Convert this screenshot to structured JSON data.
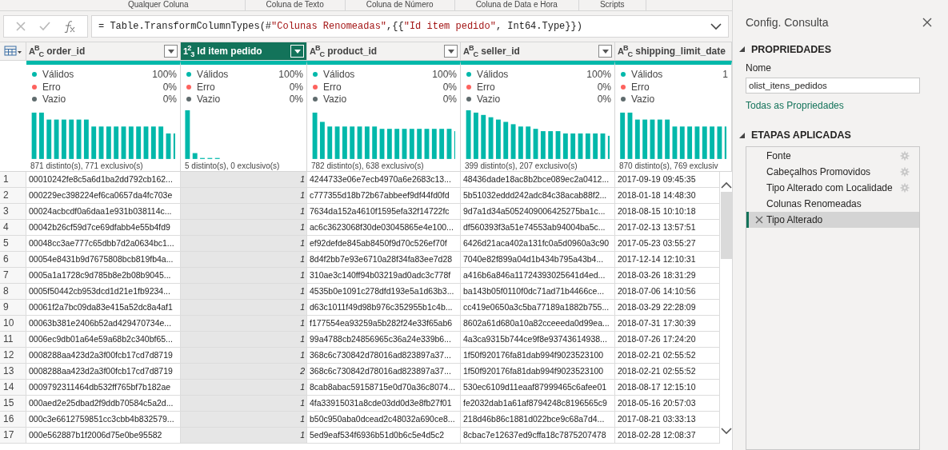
{
  "ribbon": {
    "groups": [
      "Qualquer Coluna",
      "Coluna de Texto",
      "Coluna de Número",
      "Coluna de Data e Hora",
      "Scripts"
    ]
  },
  "formula_bar": {
    "formula": "= Table.TransformColumnTypes(#\"Colunas Renomeadas\",{{\"Id item pedido\", Int64.Type}})"
  },
  "table": {
    "columns": [
      {
        "name": "order_id",
        "type_label": "A$^{B}$$_{C}$",
        "selected": false,
        "has_filter": true,
        "stats": [
          {
            "label": "Válidos",
            "value": "100%",
            "color": "#01b8aa"
          },
          {
            "label": "Erro",
            "value": "0%",
            "color": "#fd625e"
          },
          {
            "label": "Vazio",
            "value": "0%",
            "color": "#5f6b6d"
          }
        ],
        "distinct": "871 distinto(s), 771 exclusivo(s)"
      },
      {
        "name": "Id item pedido",
        "type_label": "1$^{2}$$_{3}$",
        "selected": true,
        "has_filter": true,
        "stats": [
          {
            "label": "Válidos",
            "value": "100%",
            "color": "#01b8aa"
          },
          {
            "label": "Erro",
            "value": "0%",
            "color": "#fd625e"
          },
          {
            "label": "Vazio",
            "value": "0%",
            "color": "#5f6b6d"
          }
        ],
        "distinct": "5 distinto(s), 0 exclusivo(s)"
      },
      {
        "name": "product_id",
        "type_label": "A$^{B}$$_{C}$",
        "selected": false,
        "has_filter": true,
        "stats": [
          {
            "label": "Válidos",
            "value": "100%",
            "color": "#01b8aa"
          },
          {
            "label": "Erro",
            "value": "0%",
            "color": "#fd625e"
          },
          {
            "label": "Vazio",
            "value": "0%",
            "color": "#5f6b6d"
          }
        ],
        "distinct": "782 distinto(s), 638 exclusivo(s)"
      },
      {
        "name": "seller_id",
        "type_label": "A$^{B}$$_{C}$",
        "selected": false,
        "has_filter": true,
        "stats": [
          {
            "label": "Válidos",
            "value": "100%",
            "color": "#01b8aa"
          },
          {
            "label": "Erro",
            "value": "0%",
            "color": "#fd625e"
          },
          {
            "label": "Vazio",
            "value": "0%",
            "color": "#5f6b6d"
          }
        ],
        "distinct": "399 distinto(s), 207 exclusivo(s)"
      },
      {
        "name": "shipping_limit_date",
        "type_label": "A$^{B}$$_{C}$",
        "selected": false,
        "has_filter": false,
        "stats": [
          {
            "label": "Válidos",
            "value": "1",
            "color": "#01b8aa"
          },
          {
            "label": "Erro",
            "color": "#fd625e"
          },
          {
            "label": "Vazio",
            "color": "#5f6b6d"
          }
        ],
        "distinct": "870 distinto(s), 769 exclusiv"
      }
    ],
    "rows": [
      {
        "number": "1",
        "cells": [
          "00010242fe8c5a6d1ba2dd792cb162...",
          "1",
          "4244733e06e7ecb4970a6e2683c13...",
          "48436dade18ac8b2bce089ec2a0412...",
          "2017-09-19 09:45:35"
        ]
      },
      {
        "number": "2",
        "cells": [
          "000229ec398224ef6ca0657da4fc703e",
          "1",
          "c777355d18b72b67abbeef9df44fd0fd",
          "5b51032eddd242adc84c38acab88f2...",
          "2018-01-18 14:48:30"
        ]
      },
      {
        "number": "3",
        "cells": [
          "00024acbcdf0a6daa1e931b038114c...",
          "1",
          "7634da152a4610f1595efa32f14722fc",
          "9d7a1d34a5052409006425275ba1c...",
          "2018-08-15 10:10:18"
        ]
      },
      {
        "number": "4",
        "cells": [
          "00042b26cf59d7ce69dfabb4e55b4fd9",
          "1",
          "ac6c3623068f30de03045865e4e100...",
          "df560393f3a51e74553ab94004ba5c...",
          "2017-02-13 13:57:51"
        ]
      },
      {
        "number": "5",
        "cells": [
          "00048cc3ae777c65dbb7d2a0634bc1...",
          "1",
          "ef92defde845ab8450f9d70c526ef70f",
          "6426d21aca402a131fc0a5d0960a3c90",
          "2017-05-23 03:55:27"
        ]
      },
      {
        "number": "6",
        "cells": [
          "00054e8431b9d7675808bcb819fb4a...",
          "1",
          "8d4f2bb7e93e6710a28f34fa83ee7d28",
          "7040e82f899a04d1b434b795a43b4...",
          "2017-12-14 12:10:31"
        ]
      },
      {
        "number": "7",
        "cells": [
          "0005a1a1728c9d785b8e2b08b9045...",
          "1",
          "310ae3c140ff94b03219ad0adc3c778f",
          "a416b6a846a11724393025641d4ed...",
          "2018-03-26 18:31:29"
        ]
      },
      {
        "number": "8",
        "cells": [
          "0005f50442cb953dcd1d21e1fb9234...",
          "1",
          "4535b0e1091c278dfd193e5a1d63b3...",
          "ba143b05f0110f0dc71ad71b4466ce...",
          "2018-07-06 14:10:56"
        ]
      },
      {
        "number": "9",
        "cells": [
          "00061f2a7bc09da83e415a52dc8a4af1",
          "1",
          "d63c1011f49d98b976c352955b1c4b...",
          "cc419e0650a3c5ba77189a1882b755...",
          "2018-03-29 22:28:09"
        ]
      },
      {
        "number": "10",
        "cells": [
          "00063b381e2406b52ad429470734e...",
          "1",
          "f177554ea93259a5b282f24e33f65ab6",
          "8602a61d680a10a82cceeeda0d99ea...",
          "2018-07-31 17:30:39"
        ]
      },
      {
        "number": "11",
        "cells": [
          "0006ec9db01a64e59a68b2c340bf65...",
          "1",
          "99a4788cb24856965c36a24e339b6...",
          "4a3ca9315b744ce9f8e93743614938...",
          "2018-07-26 17:24:20"
        ]
      },
      {
        "number": "12",
        "cells": [
          "0008288aa423d2a3f00fcb17cd7d8719",
          "1",
          "368c6c730842d78016ad823897a37...",
          "1f50f920176fa81dab994f9023523100",
          "2018-02-21 02:55:52"
        ]
      },
      {
        "number": "13",
        "cells": [
          "0008288aa423d2a3f00fcb17cd7d8719",
          "2",
          "368c6c730842d78016ad823897a37...",
          "1f50f920176fa81dab994f9023523100",
          "2018-02-21 02:55:52"
        ]
      },
      {
        "number": "14",
        "cells": [
          "0009792311464db532ff765bf7b182ae",
          "1",
          "8cab8abac59158715e0d70a36c8074...",
          "530ec6109d11eaaf87999465c6afee01",
          "2018-08-17 12:15:10"
        ]
      },
      {
        "number": "15",
        "cells": [
          "000aed2e25dbad2f9ddb70584c5a2d...",
          "1",
          "4fa33915031a8cde03dd0d3e8fb27f01",
          "fe2032dab1a61af8794248c8196565c9",
          "2018-05-16 20:57:03"
        ]
      },
      {
        "number": "16",
        "cells": [
          "000c3e6612759851cc3cbb4b832579...",
          "1",
          "b50c950aba0dcead2c48032a690ce8...",
          "218d46b86c1881d022bce9c68a7d4...",
          "2017-08-21 03:33:13"
        ]
      },
      {
        "number": "17",
        "cells": [
          "000e562887b1f2006d75e0be95582",
          "1",
          "5ed9eaf534f6936b51d0b6c5e4d5c2",
          "8cbac7e12637ed9cffa18c7875207478",
          "2018-02-28 12:08:37"
        ]
      }
    ]
  },
  "query_settings": {
    "title": "Config. Consulta",
    "properties_heading": "PROPRIEDADES",
    "name_label": "Nome",
    "name_value": "olist_itens_pedidos",
    "all_properties_link": "Todas as Propriedades",
    "steps_heading": "ETAPAS APLICADAS",
    "steps": [
      {
        "label": "Fonte",
        "has_settings": true,
        "selected": false
      },
      {
        "label": "Cabeçalhos Promovidos",
        "has_settings": true,
        "selected": false
      },
      {
        "label": "Tipo Alterado com Localidade",
        "has_settings": true,
        "selected": false
      },
      {
        "label": "Colunas Renomeadas",
        "has_settings": false,
        "selected": false
      },
      {
        "label": "Tipo Alterado",
        "has_settings": false,
        "selected": true
      }
    ]
  }
}
